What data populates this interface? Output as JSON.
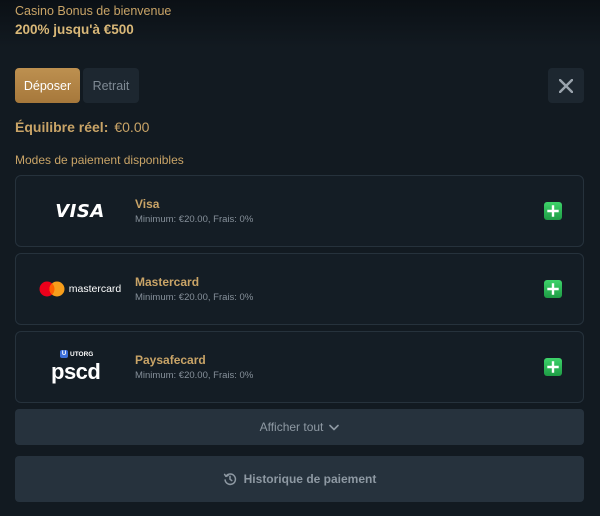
{
  "promo": {
    "label": "Casino Bonus de bienvenue",
    "offer": "200% jusqu'à €500"
  },
  "tabs": [
    {
      "label": "Déposer",
      "active": true
    },
    {
      "label": "Retrait",
      "active": false
    }
  ],
  "close_icon": "close-x-icon",
  "balance": {
    "label": "Équilibre réel:",
    "amount": "€0.00"
  },
  "section_title": "Modes de paiement disponibles",
  "methods": [
    {
      "logo_text": "VISA",
      "name": "Visa",
      "detail": "Minimum: €20.00, Frais: 0%",
      "icon": "visa-logo"
    },
    {
      "logo_text": "mastercard",
      "name": "Mastercard",
      "detail": "Minimum: €20.00, Frais: 0%",
      "icon": "mastercard-logo"
    },
    {
      "logo_badge_letter": "U",
      "logo_badge_text": "UTORG",
      "logo_text": "pscd",
      "name": "Paysafecard",
      "detail": "Minimum: €20.00, Frais: 0%",
      "icon": "paysafecard-logo"
    }
  ],
  "show_all": {
    "label": "Afficher tout",
    "icon": "chevron-down-icon"
  },
  "history": {
    "label": "Historique de paiement",
    "icon": "history-icon"
  },
  "colors": {
    "background": "#121a21",
    "accent_gold": "#c9a467",
    "deposit_button": "#b48747",
    "add_green": "#2fbf5a",
    "panel": "#26323d"
  }
}
